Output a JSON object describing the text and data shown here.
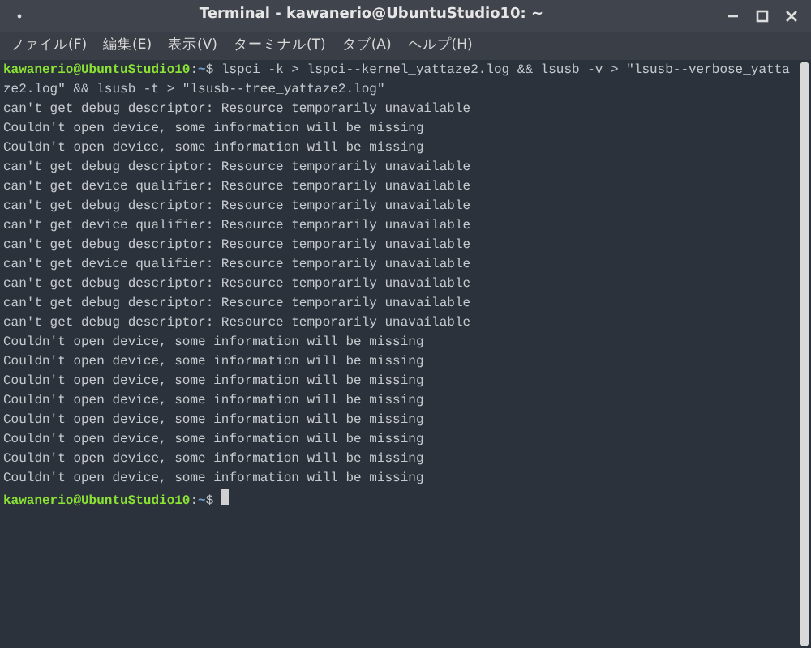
{
  "window": {
    "title": "Terminal - kawanerio@UbuntuStudio10: ~"
  },
  "menu": [
    "ファイル(F)",
    "編集(E)",
    "表示(V)",
    "ターミナル(T)",
    "タブ(A)",
    "ヘルプ(H)"
  ],
  "terminal": {
    "lines": [
      {
        "kind": "prompt",
        "user_host": "kawanerio@UbuntuStudio10",
        "separator": ":",
        "path": "~",
        "symbol": "$",
        "command": " lspci -k > lspci--kernel_yattaze2.log && lsusb -v > \"lsusb--verbose_yattaze2.log\" && lsusb -t > \"lsusb--tree_yattaze2.log\""
      },
      {
        "kind": "output",
        "text": "can't get debug descriptor: Resource temporarily unavailable"
      },
      {
        "kind": "output",
        "text": "Couldn't open device, some information will be missing"
      },
      {
        "kind": "output",
        "text": "Couldn't open device, some information will be missing"
      },
      {
        "kind": "output",
        "text": "can't get debug descriptor: Resource temporarily unavailable"
      },
      {
        "kind": "output",
        "text": "can't get device qualifier: Resource temporarily unavailable"
      },
      {
        "kind": "output",
        "text": "can't get debug descriptor: Resource temporarily unavailable"
      },
      {
        "kind": "output",
        "text": "can't get device qualifier: Resource temporarily unavailable"
      },
      {
        "kind": "output",
        "text": "can't get debug descriptor: Resource temporarily unavailable"
      },
      {
        "kind": "output",
        "text": "can't get device qualifier: Resource temporarily unavailable"
      },
      {
        "kind": "output",
        "text": "can't get debug descriptor: Resource temporarily unavailable"
      },
      {
        "kind": "output",
        "text": "can't get debug descriptor: Resource temporarily unavailable"
      },
      {
        "kind": "output",
        "text": "can't get debug descriptor: Resource temporarily unavailable"
      },
      {
        "kind": "output",
        "text": "Couldn't open device, some information will be missing"
      },
      {
        "kind": "output",
        "text": "Couldn't open device, some information will be missing"
      },
      {
        "kind": "output",
        "text": "Couldn't open device, some information will be missing"
      },
      {
        "kind": "output",
        "text": "Couldn't open device, some information will be missing"
      },
      {
        "kind": "output",
        "text": "Couldn't open device, some information will be missing"
      },
      {
        "kind": "output",
        "text": "Couldn't open device, some information will be missing"
      },
      {
        "kind": "output",
        "text": "Couldn't open device, some information will be missing"
      },
      {
        "kind": "output",
        "text": "Couldn't open device, some information will be missing"
      },
      {
        "kind": "prompt",
        "user_host": "kawanerio@UbuntuStudio10",
        "separator": ":",
        "path": "~",
        "symbol": "$",
        "cursor": true
      }
    ]
  }
}
